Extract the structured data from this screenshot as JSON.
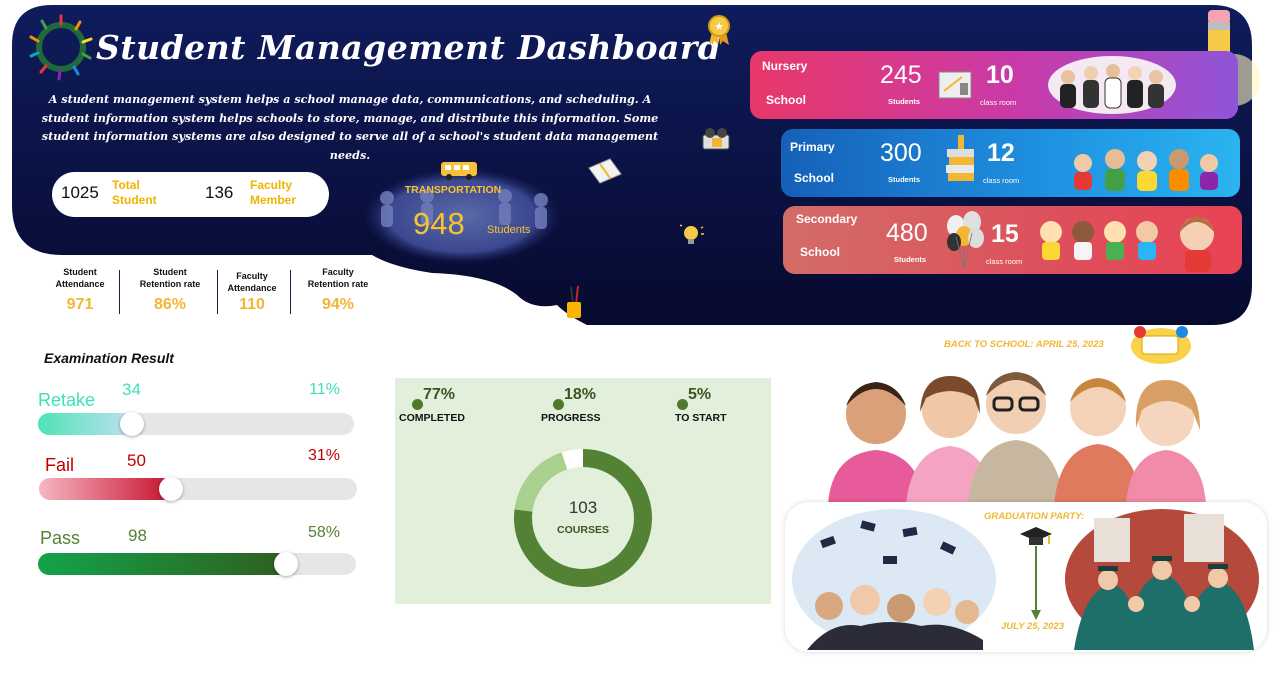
{
  "header": {
    "title": "Student Management Dashboard",
    "description": "A student management system helps a school manage data, communications, and scheduling. A student information system helps schools to store, manage, and distribute this information. Some student information systems are also designed to serve all of a school's student data management needs."
  },
  "totals": {
    "total_student_value": "1025",
    "total_student_label_1": "Total",
    "total_student_label_2": "Student",
    "faculty_value": "136",
    "faculty_label_1": "Faculty",
    "faculty_label_2": "Member"
  },
  "transportation": {
    "label": "TRANSPORTATION",
    "value": "948",
    "unit": "Students"
  },
  "stats": [
    {
      "label_1": "Student",
      "label_2": "Attendance",
      "value": "971"
    },
    {
      "label_1": "Student",
      "label_2": "Retention rate",
      "value": "86%"
    },
    {
      "label_1": "Faculty",
      "label_2": "Attendance",
      "value": "110"
    },
    {
      "label_1": "Faculty",
      "label_2": "Retention rate",
      "value": "94%"
    }
  ],
  "schools": [
    {
      "name_1": "Nursery",
      "name_2": "School",
      "students": "245",
      "students_label": "Students",
      "rooms": "10",
      "rooms_label": "class room"
    },
    {
      "name_1": "Primary",
      "name_2": "School",
      "students": "300",
      "students_label": "Students",
      "rooms": "12",
      "rooms_label": "class room"
    },
    {
      "name_1": "Secondary",
      "name_2": "School",
      "students": "480",
      "students_label": "Students",
      "rooms": "15",
      "rooms_label": "class room"
    }
  ],
  "exam": {
    "title": "Examination Result",
    "rows": [
      {
        "name": "Retake",
        "count": "34",
        "pct": "11%",
        "fraction": 0.11
      },
      {
        "name": "Fail",
        "count": "50",
        "pct": "31%",
        "fraction": 0.31
      },
      {
        "name": "Pass",
        "count": "98",
        "pct": "58%",
        "fraction": 0.58
      }
    ]
  },
  "courses": {
    "total": "103",
    "label": "COURSES",
    "legend": [
      {
        "value": "77%",
        "label": "COMPLETED"
      },
      {
        "value": "18%",
        "label": "PROGRESS"
      },
      {
        "value": "5%",
        "label": "TO START"
      }
    ]
  },
  "chart_data": {
    "type": "pie",
    "categories": [
      "COMPLETED",
      "PROGRESS",
      "TO START"
    ],
    "values": [
      77,
      18,
      5
    ],
    "colors": [
      "#548235",
      "#a9d08e",
      "#ffffff"
    ]
  },
  "events": {
    "back_to_school": "BACK TO SCHOOL: APRIL 25, 2023",
    "graduation_title": "GRADUATION PARTY:",
    "graduation_date": "JULY 25, 2023"
  },
  "colors": {
    "navy": "#0d1446",
    "gold": "#f2b632",
    "retake": "#3ee0b8",
    "fail": "#c00000",
    "pass": "#548235"
  }
}
